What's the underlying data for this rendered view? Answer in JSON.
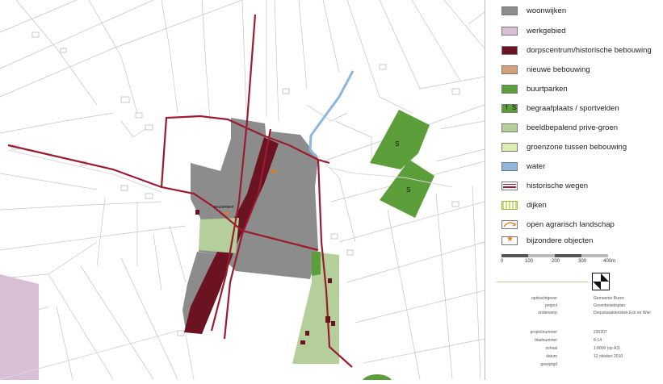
{
  "map": {
    "labels": {
      "muziektent": "muziektent",
      "park_1": "S",
      "park_2": "S"
    },
    "colors": {
      "woonwijken": "#8c8c8c",
      "werkgebied": "#d9bfd6",
      "dorpscentrum": "#6b1320",
      "buurtparken": "#5c9e3a",
      "beeldbepalend": "#b5cf9a",
      "water": "#8fb7dd",
      "historische_wegen": "#9b1b30",
      "bijzondere": "#e07b1c"
    }
  },
  "legend": {
    "items": [
      {
        "label": "woonwijken",
        "swatch": "#8c8c8c"
      },
      {
        "label": "werkgebied",
        "swatch": "#d9bfd6"
      },
      {
        "label": "dorpscentrum/historische bebouwing",
        "swatch": "#6b1320"
      },
      {
        "label": "nieuwe bebouwing",
        "swatch": "#d4a07a"
      },
      {
        "label": "buurtparken",
        "swatch": "#5c9e3a"
      },
      {
        "label": "begraafplaats / sportvelden",
        "swatch": "#5c9e3a"
      },
      {
        "label": "beeldbepalend prive-groen",
        "swatch": "#b5cf9a"
      },
      {
        "label": "groenzone tussen bebouwing",
        "swatch": "#dcebb0"
      },
      {
        "label": "water",
        "swatch": "#8fb7dd"
      },
      {
        "label": "historische wegen",
        "swatch": "historic-road-symbol"
      },
      {
        "label": "dijken",
        "swatch": "dike-hatch-symbol"
      },
      {
        "label": "open agrarisch landschap",
        "swatch": "arrow-symbol"
      },
      {
        "label": "bijzondere objecten",
        "swatch": "star-symbol"
      }
    ],
    "sport_symbols": [
      "†",
      "S"
    ],
    "scale": {
      "labels": [
        "0",
        "100",
        "200",
        "300",
        "400m"
      ]
    },
    "meta": [
      {
        "label": "opdrachtgever",
        "value": "Gemeente Buren"
      },
      {
        "label": "project",
        "value": "Groenbeleidsplan"
      },
      {
        "label": "onderwerp",
        "value": "Dorpskarakteristiek Eck en Wiel"
      },
      {
        "label": "projectnummer",
        "value": "230207"
      },
      {
        "label": "bladnummer",
        "value": "8-14"
      },
      {
        "label": "schaal",
        "value": "1:8000 (op A3)"
      },
      {
        "label": "datum",
        "value": "12 oktober 2010"
      },
      {
        "label": "gewijzigd",
        "value": ""
      }
    ]
  }
}
